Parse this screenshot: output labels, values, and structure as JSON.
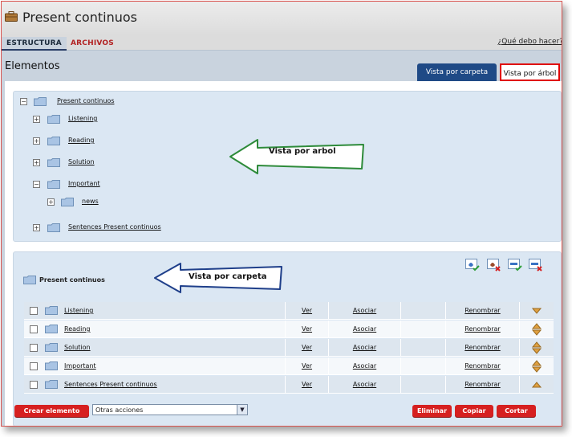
{
  "app": {
    "title": "Present continuos"
  },
  "tabs": {
    "estructura": "ESTRUCTURA",
    "archivos": "ARCHIVOS"
  },
  "help_link": "¿Qué debo hacer?",
  "section_title": "Elementos",
  "view_tabs": {
    "carpeta": "Vista por carpeta",
    "arbol": "Vista por árbol"
  },
  "tree": {
    "items": [
      {
        "label": "Present continuos",
        "expander": "−"
      },
      {
        "label": "Listening",
        "expander": "+"
      },
      {
        "label": "Reading",
        "expander": "+"
      },
      {
        "label": "Solution",
        "expander": "+"
      },
      {
        "label": "Important",
        "expander": "−"
      },
      {
        "label": "news",
        "expander": "+"
      },
      {
        "label": "Sentences Present continuos",
        "expander": "+"
      }
    ]
  },
  "callouts": {
    "arbol": "Vista por arbol",
    "carpeta": "Vista por carpeta"
  },
  "folder_view": {
    "title": "Present continuos",
    "rows": [
      {
        "name": "Listening",
        "ver": "Ver",
        "asociar": "Asociar",
        "renombrar": "Renombrar"
      },
      {
        "name": "Reading",
        "ver": "Ver",
        "asociar": "Asociar",
        "renombrar": "Renombrar"
      },
      {
        "name": "Solution",
        "ver": "Ver",
        "asociar": "Asociar",
        "renombrar": "Renombrar"
      },
      {
        "name": "Important",
        "ver": "Ver",
        "asociar": "Asociar",
        "renombrar": "Renombrar"
      },
      {
        "name": "Sentences Present continuos",
        "ver": "Ver",
        "asociar": "Asociar",
        "renombrar": "Renombrar"
      }
    ]
  },
  "actions": {
    "crear": "Crear elemento",
    "otras": "Otras acciones",
    "eliminar": "Eliminar",
    "copiar": "Copiar",
    "cortar": "Cortar"
  },
  "colors": {
    "accent_red": "#d62020",
    "tab_blue": "#1f4a86",
    "panel": "#dbe7f3",
    "folder": "#a9c4e4"
  },
  "icons": [
    "briefcase-icon",
    "folder-icon",
    "expand-icon",
    "collapse-icon",
    "add-folder-icon",
    "delete-folder-icon",
    "add-item-icon",
    "delete-item-icon",
    "move-up-icon",
    "move-down-icon",
    "dropdown-arrow-icon"
  ]
}
